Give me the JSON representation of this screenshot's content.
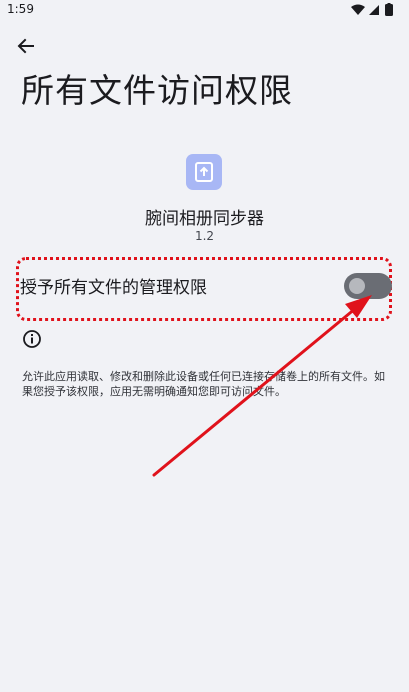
{
  "status_bar": {
    "time": "1:59"
  },
  "page": {
    "title": "所有文件访问权限"
  },
  "app": {
    "name": "腕间相册同步器",
    "version": "1.2"
  },
  "permission": {
    "label": "授予所有文件的管理权限",
    "enabled": false
  },
  "description": "允许此应用读取、修改和删除此设备或任何已连接存储卷上的所有文件。如果您授予该权限，应用无需明确通知您即可访问文件。",
  "annotation": {
    "color": "#e0121b"
  },
  "icons": [
    "back-arrow-icon",
    "app-upload-icon",
    "info-icon",
    "wifi-icon",
    "signal-icon",
    "battery-icon"
  ]
}
